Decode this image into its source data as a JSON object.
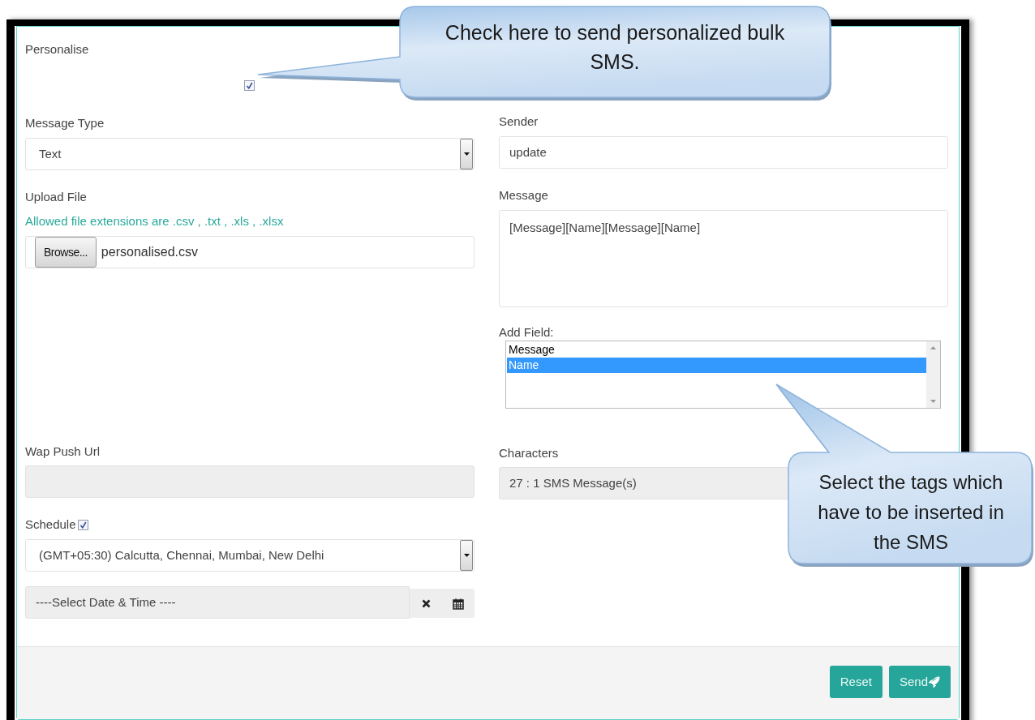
{
  "personalise": {
    "label": "Personalise",
    "checked": true
  },
  "message_type": {
    "label": "Message Type",
    "value": "Text"
  },
  "upload_file": {
    "label": "Upload File",
    "hint": "Allowed file extensions are .csv , .txt , .xls , .xlsx",
    "button": "Browse...",
    "value": "personalised.csv"
  },
  "sender": {
    "label": "Sender",
    "value": "update"
  },
  "message": {
    "label": "Message",
    "value": "[Message][Name][Message][Name]"
  },
  "add_field": {
    "label": "Add Field:",
    "options": [
      {
        "label": "Message",
        "selected": false
      },
      {
        "label": "Name",
        "selected": true
      }
    ]
  },
  "wap_push_url": {
    "label": "Wap Push Url"
  },
  "characters": {
    "label": "Characters",
    "value": "27 : 1 SMS Message(s)"
  },
  "schedule": {
    "label": "Schedule",
    "checked": true,
    "timezone": "(GMT+05:30) Calcutta, Chennai, Mumbai, New Delhi",
    "datetime_placeholder": "----Select Date & Time ----"
  },
  "buttons": [
    {
      "label": "Reset",
      "kind": "reset"
    },
    {
      "label": "Send",
      "kind": "send"
    }
  ],
  "callouts": [
    {
      "text": "Check here to send personalized bulk SMS."
    },
    {
      "text": "Select the tags which have to be inserted in the SMS"
    }
  ]
}
